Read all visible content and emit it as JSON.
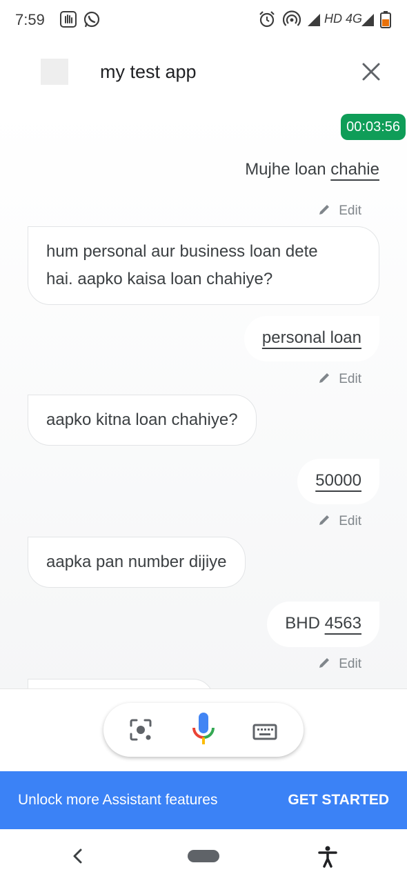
{
  "status_bar": {
    "time": "7:59",
    "network": "HD 4G",
    "icons": [
      "hand-badge-icon",
      "whatsapp-icon",
      "alarm-icon",
      "hotspot-icon",
      "signal-icon",
      "battery-icon"
    ]
  },
  "header": {
    "title": "my test app",
    "close_icon": "close-icon"
  },
  "conversation": {
    "timer": "00:03:56",
    "edit_label": "Edit",
    "messages": [
      {
        "role": "user",
        "plain": "Mujhe loan ",
        "underlined": "chahie"
      },
      {
        "role": "assistant",
        "line1": "hum personal aur business loan dete",
        "line2": "hai. aapko kaisa loan chahiye?"
      },
      {
        "role": "user",
        "plain": "",
        "underlined": "personal loan"
      },
      {
        "role": "assistant",
        "text": "aapko kitna loan chahiye?"
      },
      {
        "role": "user",
        "plain": "",
        "underlined": "50000"
      },
      {
        "role": "assistant",
        "text": "aapka pan number dijiye"
      },
      {
        "role": "user",
        "plain": "BHD ",
        "underlined": "4563"
      }
    ]
  },
  "input_bar": {
    "buttons": [
      "lens-icon",
      "microphone-icon",
      "keyboard-icon"
    ]
  },
  "promo": {
    "text": "Unlock more Assistant features",
    "button": "GET STARTED",
    "color": "#3b82f6"
  },
  "nav_bar": {
    "icons": [
      "back-icon",
      "home-pill",
      "accessibility-icon"
    ]
  },
  "colors": {
    "timer_green": "#0f9d58",
    "mic_blue": "#4285f4",
    "mic_red": "#ea4335",
    "mic_yellow": "#fbbc05",
    "mic_green": "#34a853"
  }
}
